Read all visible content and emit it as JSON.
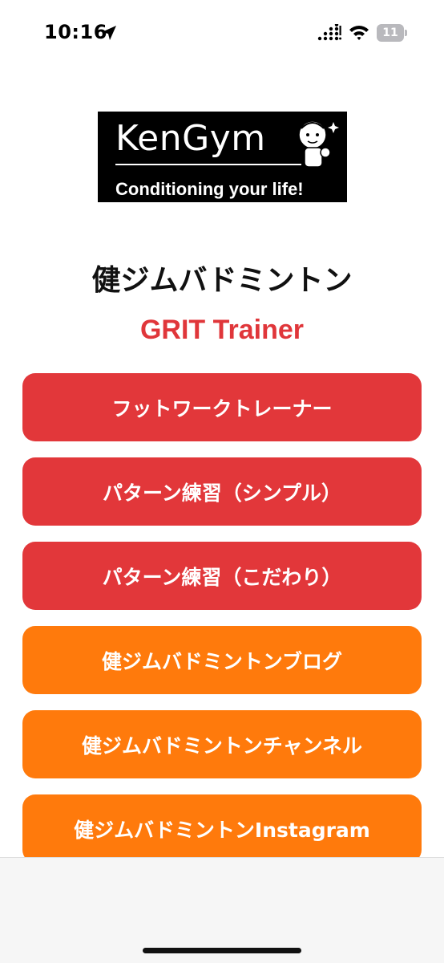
{
  "status_bar": {
    "time": "10:16",
    "battery_level": "11",
    "icons": [
      "location-arrow-icon",
      "cellular-signal-icon",
      "wifi-icon",
      "battery-icon"
    ]
  },
  "logo": {
    "brand_text": "KenGym",
    "tagline": "Conditioning your life!"
  },
  "header": {
    "title": "健ジムバドミントン",
    "subtitle": "GRIT Trainer"
  },
  "menu": {
    "buttons": [
      {
        "label": "フットワークトレーナー",
        "color": "#e2373a"
      },
      {
        "label": "パターン練習（シンプル）",
        "color": "#e2373a"
      },
      {
        "label": "パターン練習（こだわり）",
        "color": "#e2373a"
      },
      {
        "label": "健ジムバドミントンブログ",
        "color": "#ff7a0c"
      },
      {
        "label": "健ジムバドミントンチャンネル",
        "color": "#ff7a0c"
      },
      {
        "label": "健ジムバドミントンInstagram",
        "color": "#ff7a0c"
      }
    ]
  },
  "colors": {
    "accent_red": "#e2373a",
    "accent_orange": "#ff7a0c",
    "subtitle_red": "#e0363a"
  }
}
